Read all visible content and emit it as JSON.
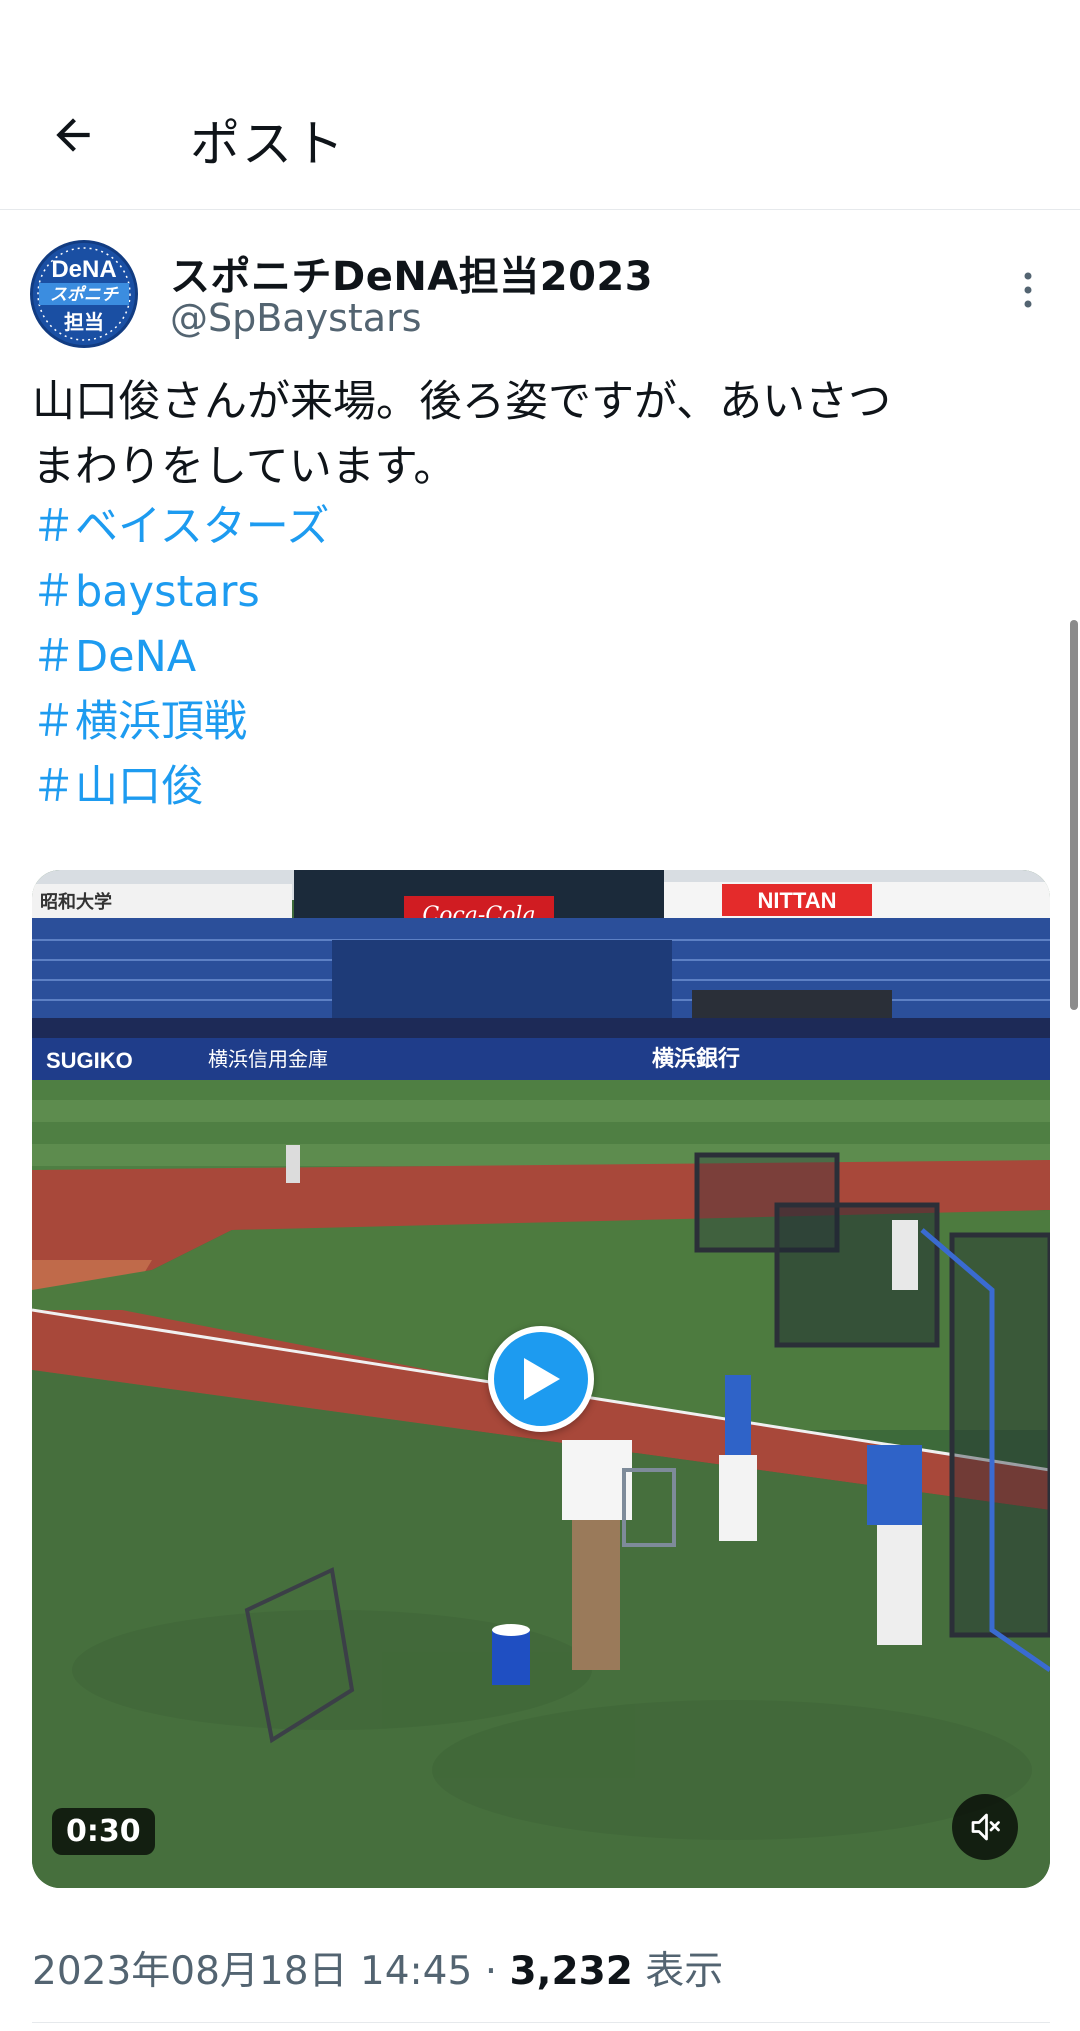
{
  "header": {
    "title": "ポスト",
    "back_icon": "arrow-left-icon"
  },
  "author": {
    "display_name": "スポニチDeNA担当2023",
    "handle": "@SpBaystars",
    "avatar_text_top": "DeNA",
    "avatar_text_mid": "スポニチ",
    "avatar_text_bottom": "担当"
  },
  "tweet": {
    "text_line1": "山口俊さんが来場。後ろ姿ですが、あいさつ",
    "text_line2": "まわりをしています。",
    "hashtags": [
      "＃ベイスターズ",
      "＃baystars",
      "＃DeNA",
      "＃横浜頂戦",
      "＃山口俊"
    ]
  },
  "video": {
    "duration": "0:30",
    "play_icon": "play-icon",
    "mute_icon": "speaker-muted-icon",
    "ad_banners": {
      "showa": "昭和大学",
      "cocacola": "Coca-Cola",
      "nittan": "NITTAN",
      "sugiko": "SUGIKO",
      "yokohama_shinkin": "横浜信用金庫",
      "yokohama_bank": "横浜銀行"
    }
  },
  "meta": {
    "datetime": "2023年08月18日 14:45",
    "separator": "·",
    "views_count": "3,232",
    "views_label": "表示"
  },
  "colors": {
    "accent": "#1d9bf0",
    "secondary_text": "#536471",
    "primary_text": "#0f1419"
  }
}
